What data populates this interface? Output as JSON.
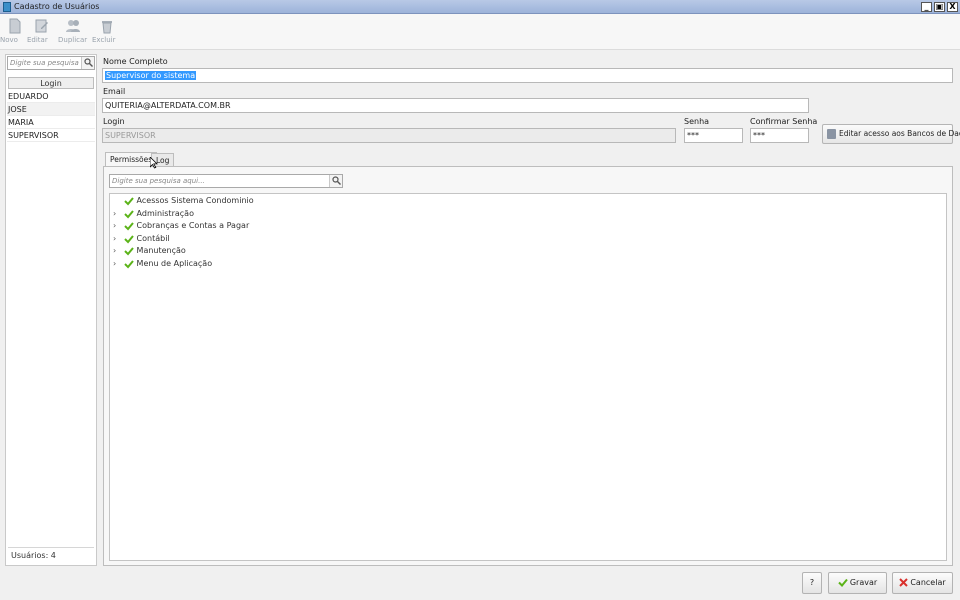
{
  "window": {
    "title": "Cadastro de Usuários",
    "controls": [
      "_",
      "▣",
      "X"
    ]
  },
  "toolbar": {
    "buttons": [
      {
        "label": "Novo",
        "icon": "new-document-icon"
      },
      {
        "label": "Editar",
        "icon": "edit-icon"
      },
      {
        "label": "Duplicar",
        "icon": "users-icon"
      },
      {
        "label": "Excluir",
        "icon": "trash-icon"
      }
    ]
  },
  "sidebar": {
    "search_placeholder": "Digite sua pesquisa aqui...",
    "column_header": "Login",
    "items": [
      "EDUARDO",
      "JOSE",
      "MARIA",
      "SUPERVISOR"
    ],
    "footer": "Usuários: 4"
  },
  "form": {
    "nome_label": "Nome Completo",
    "nome_value": "Supervisor do sistema",
    "email_label": "Email",
    "email_value": "QUITERIA@ALTERDATA.COM.BR",
    "login_label": "Login",
    "login_value": "SUPERVISOR",
    "senha_label": "Senha",
    "senha_value": "***",
    "confirmar_label": "Confirmar Senha",
    "confirmar_value": "***",
    "edit_db_button": "Editar acesso aos Bancos de Dados"
  },
  "tabs": [
    {
      "label": "Permissões",
      "active": true
    },
    {
      "label": "Log",
      "active": false
    }
  ],
  "permissions": {
    "search_placeholder": "Digite sua pesquisa aqui...",
    "tree": [
      {
        "label": "Acessos Sistema Condominio",
        "expandable": false
      },
      {
        "label": "Administração",
        "expandable": true
      },
      {
        "label": "Cobranças e Contas a Pagar",
        "expandable": true
      },
      {
        "label": "Contábil",
        "expandable": true
      },
      {
        "label": "Manutenção",
        "expandable": true
      },
      {
        "label": "Menu de Aplicação",
        "expandable": true
      }
    ]
  },
  "footer": {
    "help_label": "?",
    "save_label": "Gravar",
    "cancel_label": "Cancelar"
  },
  "colors": {
    "check_green": "#5bb318",
    "selection_blue": "#3399ff",
    "cancel_red": "#d9302c"
  }
}
